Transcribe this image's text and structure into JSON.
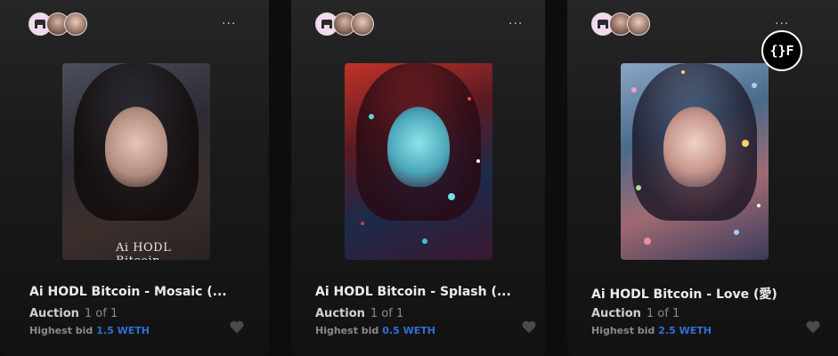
{
  "cards": [
    {
      "title": "Ai HODL Bitcoin - Mosaic (...",
      "sale_type": "Auction",
      "edition": "1 of 1",
      "bid_label": "Highest bid",
      "bid_value": "1.5 WETH",
      "art_text": "Ai HODL Bitcoin",
      "menu_icon": "more-horizontal-icon",
      "like_icon": "heart-icon"
    },
    {
      "title": "Ai HODL Bitcoin - Splash (...",
      "sale_type": "Auction",
      "edition": "1 of 1",
      "bid_label": "Highest bid",
      "bid_value": "0.5 WETH",
      "menu_icon": "more-horizontal-icon",
      "like_icon": "heart-icon"
    },
    {
      "title": "Ai HODL Bitcoin - Love (愛)",
      "sale_type": "Auction",
      "edition": "1 of 1",
      "bid_label": "Highest bid",
      "bid_value": "2.5 WETH",
      "menu_icon": "more-horizontal-icon",
      "like_icon": "heart-icon"
    }
  ],
  "menu_glyph": "···",
  "watermark_text": "{}F",
  "colors": {
    "accent_blue": "#2f6fd6",
    "background": "#0d0d0d"
  }
}
